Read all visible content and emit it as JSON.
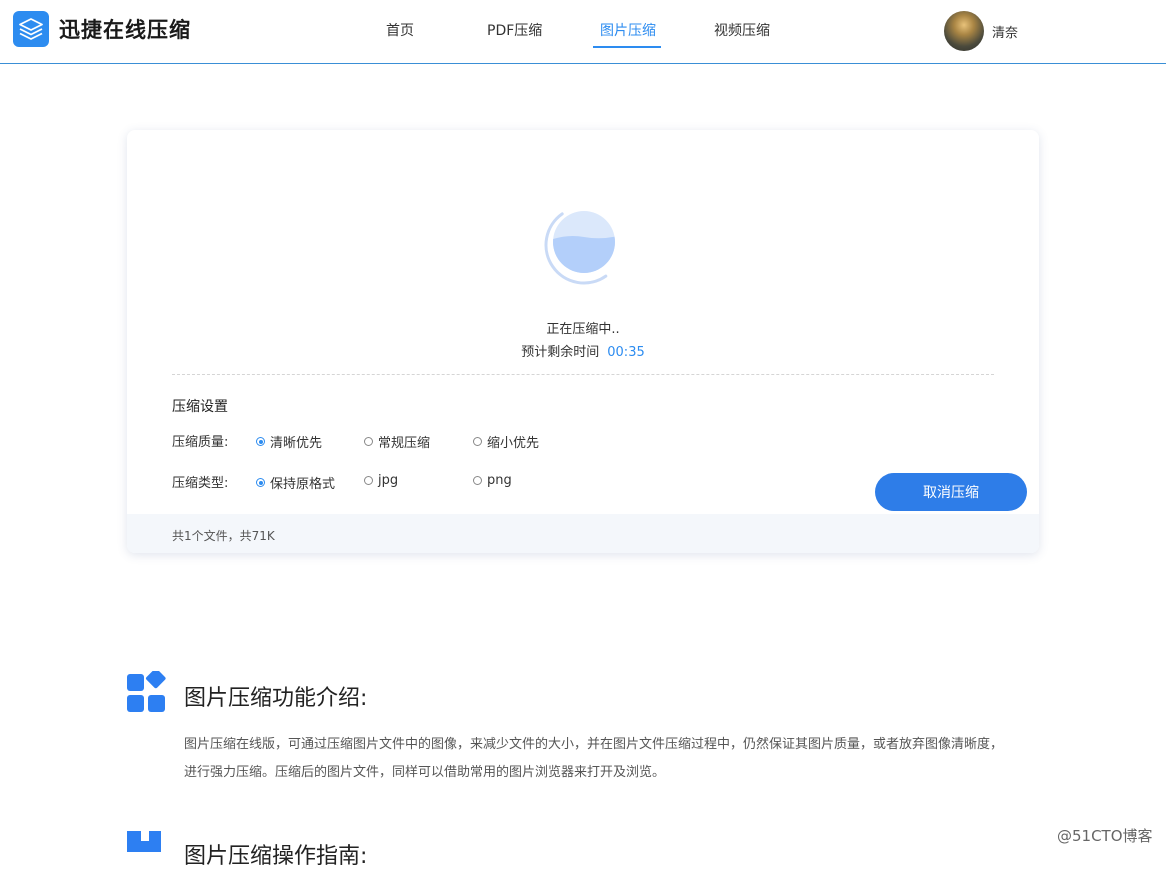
{
  "header": {
    "logo_text": "迅捷在线压缩",
    "logo_icon": "layers-stack-icon",
    "nav": [
      {
        "label": "首页",
        "active": false
      },
      {
        "label": "PDF压缩",
        "active": false
      },
      {
        "label": "图片压缩",
        "active": true
      },
      {
        "label": "视频压缩",
        "active": false
      }
    ],
    "username": "清奈"
  },
  "compress_card": {
    "status_text": "正在压缩中..",
    "remaining_label": "预计剩余时间",
    "remaining_time": "00:35",
    "progress_fill": 0.5,
    "settings_title": "压缩设置",
    "quality": {
      "label": "压缩质量:",
      "options": [
        "清晰优先",
        "常规压缩",
        "缩小优先"
      ],
      "selected": "清晰优先"
    },
    "type": {
      "label": "压缩类型:",
      "options": [
        "保持原格式",
        "jpg",
        "png"
      ],
      "selected": "保持原格式"
    },
    "cancel_label": "取消压缩",
    "file_info": "共1个文件，共71K"
  },
  "intro": {
    "title": "图片压缩功能介绍:",
    "line1": "图片压缩在线版，可通过压缩图片文件中的图像，来减少文件的大小，并在图片文件压缩过程中，仍然保证其图片质量，或者放弃图像清晰度，",
    "line2": "进行强力压缩。压缩后的图片文件，同样可以借助常用的图片浏览器来打开及浏览。",
    "icon": "apps-grid-icon"
  },
  "guide": {
    "title": "图片压缩操作指南:",
    "icon": "book-icon"
  },
  "watermark": "@51CTO博客",
  "colors": {
    "accent": "#2d8cf0",
    "button": "#2e7de8",
    "footer_bg": "#f4f7fb"
  }
}
